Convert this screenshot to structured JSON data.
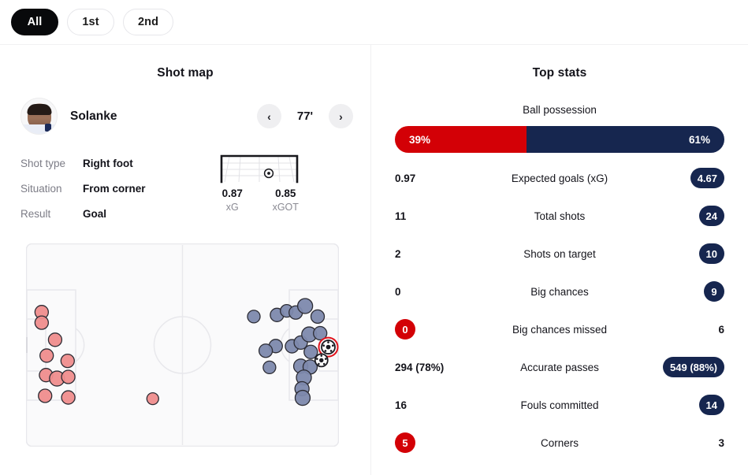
{
  "period_filter": {
    "options": [
      {
        "label": "All",
        "active": true
      },
      {
        "label": "1st",
        "active": false
      },
      {
        "label": "2nd",
        "active": false
      }
    ]
  },
  "shot_map": {
    "title": "Shot map",
    "player_name": "Solanke",
    "minute": "77'",
    "prev_icon": "chevron-left-icon",
    "next_icon": "chevron-right-icon",
    "details": [
      {
        "label": "Shot type",
        "value": "Right foot"
      },
      {
        "label": "Situation",
        "value": "From corner"
      },
      {
        "label": "Result",
        "value": "Goal"
      }
    ],
    "goalmouth": {
      "xg_value": "0.87",
      "xg_key": "xG",
      "xgot_value": "0.85",
      "xgot_key": "xGOT"
    }
  },
  "top_stats": {
    "title": "Top stats",
    "possession": {
      "label": "Ball possession",
      "home_value": "39%",
      "away_value": "61%",
      "home_pct": 39,
      "away_pct": 61,
      "home_color": "#d30006",
      "away_color": "#16264f"
    },
    "rows": [
      {
        "home": "0.97",
        "name": "Expected goals (xG)",
        "away": "4.67",
        "highlight": "away"
      },
      {
        "home": "11",
        "name": "Total shots",
        "away": "24",
        "highlight": "away"
      },
      {
        "home": "2",
        "name": "Shots on target",
        "away": "10",
        "highlight": "away"
      },
      {
        "home": "0",
        "name": "Big chances",
        "away": "9",
        "highlight": "away"
      },
      {
        "home": "0",
        "name": "Big chances missed",
        "away": "6",
        "highlight": "home"
      },
      {
        "home": "294 (78%)",
        "name": "Accurate passes",
        "away": "549 (88%)",
        "highlight": "away"
      },
      {
        "home": "16",
        "name": "Fouls committed",
        "away": "14",
        "highlight": "away"
      },
      {
        "home": "5",
        "name": "Corners",
        "away": "3",
        "highlight": "home"
      }
    ]
  },
  "chart_data": {
    "type": "scatter",
    "title": "Shot map",
    "xlabel": "",
    "ylabel": "",
    "xlim": [
      0,
      100
    ],
    "ylim": [
      0,
      100
    ],
    "grid": false,
    "legend": "none",
    "note": "Football pitch shot locations. Home team (red) attacks toward left goal; away team (navy) attacks toward right goal. Marker radius scales with xG. 'goal' markers drawn as football icons; the selected shot carries a red highlight ring.",
    "series": [
      {
        "name": "Home shots",
        "color": "#ef8d8d",
        "points": [
          {
            "x": 5.0,
            "y": 33.8,
            "r": 8.5,
            "type": "shot"
          },
          {
            "x": 5.0,
            "y": 39.0,
            "r": 8.5,
            "type": "shot"
          },
          {
            "x": 9.3,
            "y": 47.4,
            "r": 8.5,
            "type": "shot"
          },
          {
            "x": 6.6,
            "y": 55.2,
            "r": 8.5,
            "type": "shot"
          },
          {
            "x": 13.3,
            "y": 57.8,
            "r": 8.5,
            "type": "shot"
          },
          {
            "x": 6.4,
            "y": 64.8,
            "r": 8.5,
            "type": "shot"
          },
          {
            "x": 9.9,
            "y": 66.5,
            "r": 9.5,
            "type": "shot"
          },
          {
            "x": 13.5,
            "y": 65.7,
            "r": 8.5,
            "type": "shot"
          },
          {
            "x": 6.1,
            "y": 75.0,
            "r": 8.5,
            "type": "shot"
          },
          {
            "x": 13.5,
            "y": 75.8,
            "r": 8.5,
            "type": "shot"
          },
          {
            "x": 40.5,
            "y": 76.4,
            "r": 7.5,
            "type": "shot"
          }
        ]
      },
      {
        "name": "Away shots",
        "color": "#7d89ad",
        "points": [
          {
            "x": 72.8,
            "y": 36.0,
            "r": 8.0,
            "type": "shot"
          },
          {
            "x": 80.2,
            "y": 35.2,
            "r": 8.5,
            "type": "shot"
          },
          {
            "x": 83.3,
            "y": 33.2,
            "r": 8.0,
            "type": "shot"
          },
          {
            "x": 86.2,
            "y": 34.0,
            "r": 8.5,
            "type": "shot"
          },
          {
            "x": 89.2,
            "y": 30.8,
            "r": 9.5,
            "type": "shot"
          },
          {
            "x": 93.2,
            "y": 36.0,
            "r": 8.5,
            "type": "shot"
          },
          {
            "x": 79.8,
            "y": 50.5,
            "r": 8.5,
            "type": "shot"
          },
          {
            "x": 76.6,
            "y": 52.8,
            "r": 8.5,
            "type": "shot"
          },
          {
            "x": 85.0,
            "y": 50.6,
            "r": 8.5,
            "type": "shot"
          },
          {
            "x": 87.8,
            "y": 48.8,
            "r": 8.5,
            "type": "shot"
          },
          {
            "x": 90.5,
            "y": 44.8,
            "r": 9.5,
            "type": "shot"
          },
          {
            "x": 94.0,
            "y": 44.2,
            "r": 8.5,
            "type": "shot"
          },
          {
            "x": 91.0,
            "y": 53.4,
            "r": 8.5,
            "type": "shot"
          },
          {
            "x": 77.8,
            "y": 61.0,
            "r": 8.0,
            "type": "shot"
          },
          {
            "x": 87.8,
            "y": 60.4,
            "r": 9.0,
            "type": "shot"
          },
          {
            "x": 90.8,
            "y": 60.8,
            "r": 9.0,
            "type": "shot"
          },
          {
            "x": 88.8,
            "y": 66.0,
            "r": 9.5,
            "type": "shot"
          },
          {
            "x": 88.2,
            "y": 71.5,
            "r": 9.0,
            "type": "shot"
          },
          {
            "x": 88.4,
            "y": 76.0,
            "r": 9.5,
            "type": "shot"
          },
          {
            "x": 96.6,
            "y": 51.0,
            "r": 8.5,
            "type": "goal",
            "selected": true
          },
          {
            "x": 94.4,
            "y": 57.5,
            "r": 8.0,
            "type": "goal",
            "selected": false
          }
        ]
      }
    ],
    "selected_shot": {
      "player": "Solanke",
      "minute": "77'",
      "shot_type": "Right foot",
      "situation": "From corner",
      "result": "Goal",
      "xG": 0.87,
      "xGOT": 0.85
    }
  }
}
